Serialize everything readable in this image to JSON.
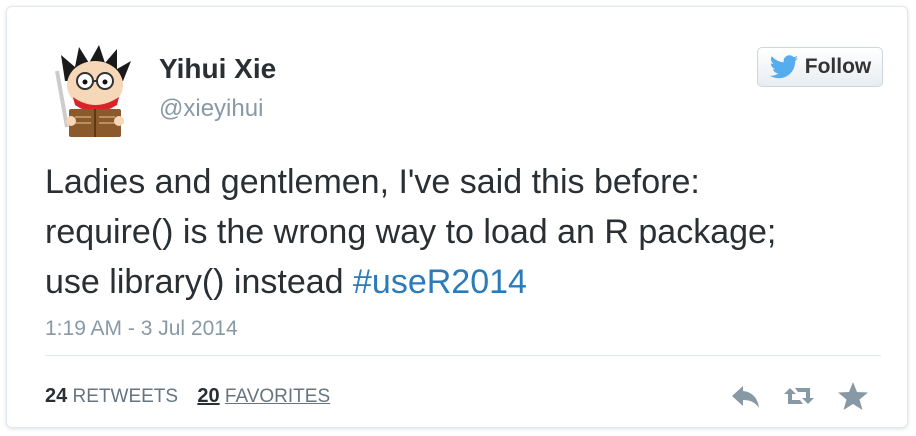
{
  "author": {
    "name": "Yihui Xie",
    "handle": "@xieyihui"
  },
  "follow_button": {
    "label": "Follow"
  },
  "tweet": {
    "text_line1": "Ladies and gentlemen, I've said this before:",
    "text_line2": "require() is the wrong way to load an R package;",
    "text_line3_prefix": "use library() instead ",
    "hashtag": "#useR2014",
    "timestamp": "1:19 AM - 3 Jul 2014"
  },
  "stats": {
    "retweets_count": "24",
    "retweets_label": "RETWEETS",
    "favorites_count": "20",
    "favorites_label": "FAVORITES"
  },
  "actions": [
    "reply-icon",
    "retweet-icon",
    "favorite-icon"
  ],
  "colors": {
    "text": "#292f33",
    "muted": "#8899a6",
    "link": "#2b7bb9",
    "twitter_blue": "#55acee",
    "icon": "#8899a6"
  }
}
